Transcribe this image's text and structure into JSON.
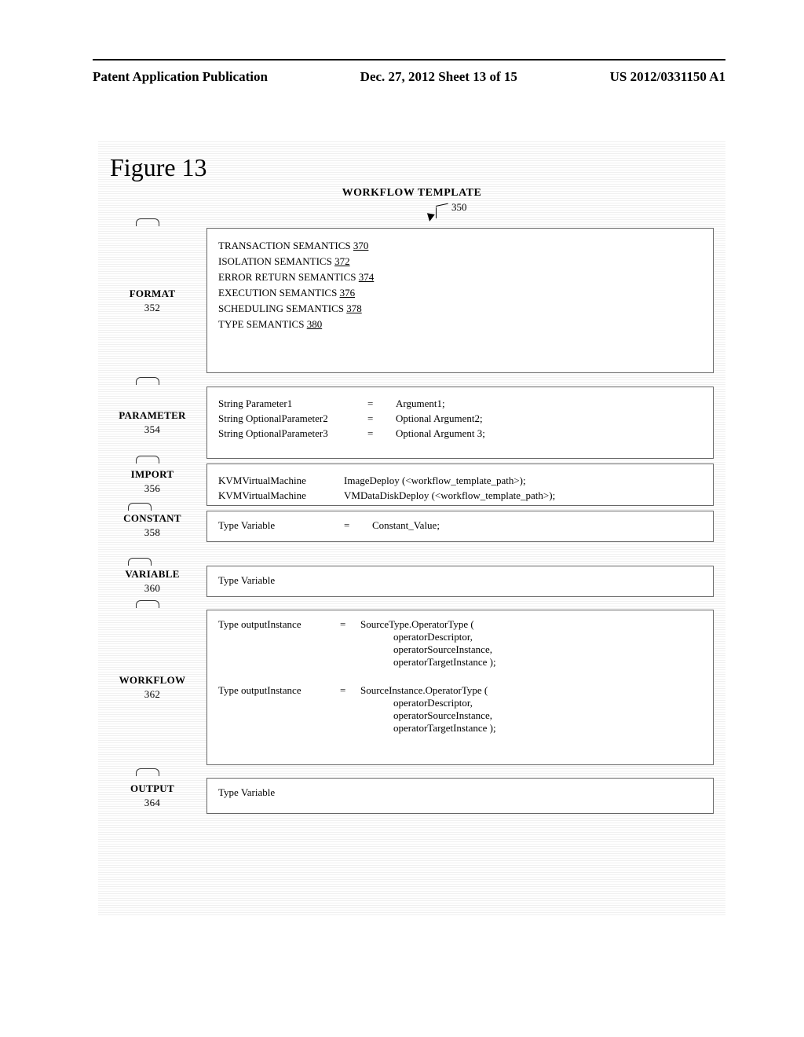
{
  "header": {
    "left": "Patent Application Publication",
    "center": "Dec. 27, 2012  Sheet 13 of 15",
    "right": "US 2012/0331150 A1"
  },
  "figure": {
    "title": "Figure 13",
    "workflow_title": "WORKFLOW TEMPLATE",
    "ref_350": "350"
  },
  "sections": {
    "format": {
      "label": "FORMAT",
      "ref": "352"
    },
    "parameter": {
      "label": "PARAMETER",
      "ref": "354"
    },
    "import": {
      "label": "IMPORT",
      "ref": "356"
    },
    "constant": {
      "label": "CONSTANT",
      "ref": "358"
    },
    "variable": {
      "label": "VARIABLE",
      "ref": "360"
    },
    "workflow": {
      "label": "WORKFLOW",
      "ref": "362"
    },
    "output": {
      "label": "OUTPUT",
      "ref": "364"
    }
  },
  "format_box": {
    "l1": {
      "text": "TRANSACTION SEMANTICS ",
      "ref": "370"
    },
    "l2": {
      "text": "ISOLATION SEMANTICS ",
      "ref": "372"
    },
    "l3": {
      "text": "ERROR RETURN SEMANTICS ",
      "ref": "374"
    },
    "l4": {
      "text": "EXECUTION SEMANTICS ",
      "ref": "376"
    },
    "l5": {
      "text": "SCHEDULING SEMANTICS ",
      "ref": "378"
    },
    "l6": {
      "text": "TYPE SEMANTICS ",
      "ref": "380"
    }
  },
  "parameter_box": {
    "r1": {
      "c1": "String Parameter1",
      "c2": "=",
      "c3": "Argument1;"
    },
    "r2": {
      "c1": "String OptionalParameter2",
      "c2": "=",
      "c3": "Optional Argument2;"
    },
    "r3": {
      "c1": "String OptionalParameter3",
      "c2": "=",
      "c3": "Optional Argument 3;"
    }
  },
  "import_box": {
    "r1": {
      "c1": "KVMVirtualMachine",
      "c2": "ImageDeploy (<workflow_template_path>);"
    },
    "r2": {
      "c1": "KVMVirtualMachine",
      "c2": "VMDataDiskDeploy (<workflow_template_path>);"
    }
  },
  "constant_box": {
    "c1": "Type Variable",
    "c2": "=",
    "c3": "Constant_Value;"
  },
  "variable_box": {
    "text": "Type Variable"
  },
  "workflow_box": {
    "b1": {
      "c1": "Type outputInstance",
      "c2": "=",
      "l1": "SourceType.OperatorType (",
      "l2": "operatorDescriptor,",
      "l3": "operatorSourceInstance,",
      "l4": "operatorTargetInstance );"
    },
    "b2": {
      "c1": "Type outputInstance",
      "c2": "=",
      "l1": "SourceInstance.OperatorType (",
      "l2": "operatorDescriptor,",
      "l3": "operatorSourceInstance,",
      "l4": "operatorTargetInstance );"
    }
  },
  "output_box": {
    "text": "Type Variable"
  }
}
